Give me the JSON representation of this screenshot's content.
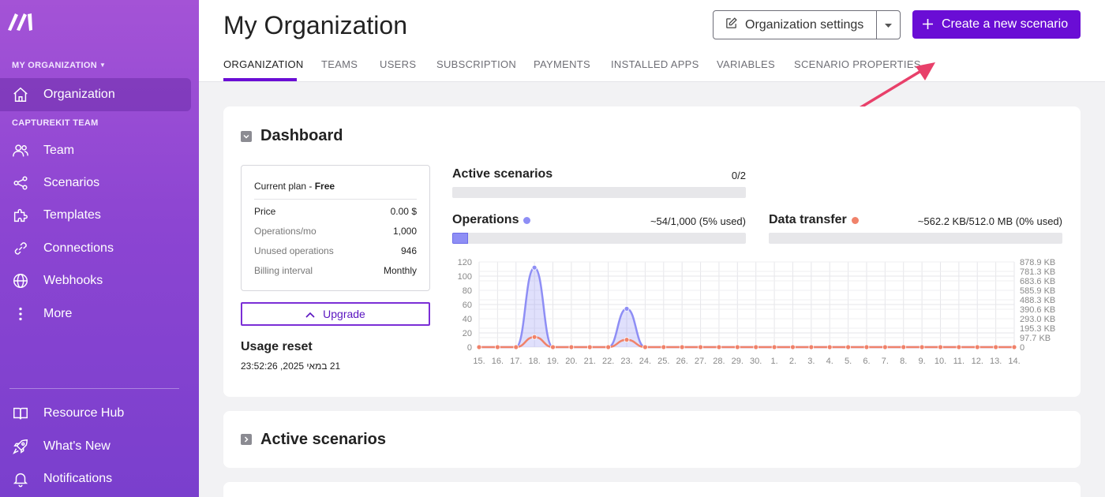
{
  "sidebar": {
    "org_switch": "MY ORGANIZATION",
    "org_item": "Organization",
    "team_label": "CAPTUREKIT TEAM",
    "items": [
      {
        "label": "Team",
        "icon": "users-icon"
      },
      {
        "label": "Scenarios",
        "icon": "share-icon"
      },
      {
        "label": "Templates",
        "icon": "puzzle-icon"
      },
      {
        "label": "Connections",
        "icon": "link-icon"
      },
      {
        "label": "Webhooks",
        "icon": "globe-icon"
      },
      {
        "label": "More",
        "icon": "more-vertical-icon"
      }
    ],
    "bottom_items": [
      {
        "label": "Resource Hub",
        "icon": "book-icon"
      },
      {
        "label": "What's New",
        "icon": "rocket-icon"
      },
      {
        "label": "Notifications",
        "icon": "bell-icon"
      }
    ]
  },
  "header": {
    "title": "My Organization",
    "settings_button": "Organization settings",
    "create_button": "Create a new scenario",
    "tabs": [
      "ORGANIZATION",
      "TEAMS",
      "USERS",
      "SUBSCRIPTION",
      "PAYMENTS",
      "INSTALLED APPS",
      "VARIABLES",
      "SCENARIO PROPERTIES"
    ],
    "active_tab": "ORGANIZATION"
  },
  "dashboard": {
    "title": "Dashboard",
    "plan": {
      "label": "Current plan - ",
      "name": "Free",
      "rows": [
        {
          "k": "Price",
          "v": "0.00 $"
        },
        {
          "k": "Operations/mo",
          "v": "1,000"
        },
        {
          "k": "Unused operations",
          "v": "946"
        },
        {
          "k": "Billing interval",
          "v": "Monthly"
        }
      ]
    },
    "upgrade_button": "Upgrade",
    "usage_reset_label": "Usage reset",
    "usage_reset_date": "21 במאי 2025, 23:52:26",
    "active_scenarios": {
      "label": "Active scenarios",
      "value": "0/2",
      "fraction": 0
    },
    "operations": {
      "label": "Operations",
      "value": "~54/1,000 (5% used)",
      "fraction": 0.054,
      "color": "#8e8ef5"
    },
    "data_transfer": {
      "label": "Data transfer",
      "value": "~562.2 KB/512.0 MB (0% used)",
      "fraction": 0.001,
      "color": "#f0826a"
    }
  },
  "active_scenarios_section": {
    "title": "Active scenarios"
  },
  "chart_data": {
    "type": "line",
    "categories": [
      "15.",
      "16.",
      "17.",
      "18.",
      "19.",
      "20.",
      "21.",
      "22.",
      "23.",
      "24.",
      "25.",
      "26.",
      "27.",
      "28.",
      "29.",
      "30.",
      "1.",
      "2.",
      "3.",
      "4.",
      "5.",
      "6.",
      "7.",
      "8.",
      "9.",
      "10.",
      "11.",
      "12.",
      "13.",
      "14."
    ],
    "series": [
      {
        "name": "Operations",
        "axis": "left",
        "color": "#8e8ef5",
        "values": [
          0,
          0,
          0,
          112,
          0,
          0,
          0,
          0,
          54,
          0,
          0,
          0,
          0,
          0,
          0,
          0,
          0,
          0,
          0,
          0,
          0,
          0,
          0,
          0,
          0,
          0,
          0,
          0,
          0,
          0
        ]
      },
      {
        "name": "Data transfer",
        "axis": "right",
        "color": "#f0826a",
        "values": [
          0,
          0,
          0,
          104,
          0,
          0,
          0,
          0,
          76,
          0,
          0,
          0,
          0,
          0,
          0,
          0,
          0,
          0,
          0,
          0,
          0,
          0,
          0,
          0,
          0,
          0,
          0,
          0,
          0,
          0
        ]
      }
    ],
    "ylim_left": [
      0,
      120
    ],
    "yticks_left": [
      "0",
      "20",
      "40",
      "60",
      "80",
      "100",
      "120"
    ],
    "ylim_right": [
      0,
      878.9
    ],
    "yticks_right": [
      "0",
      "97.7 KB",
      "195.3 KB",
      "293.0 KB",
      "390.6 KB",
      "488.3 KB",
      "585.9 KB",
      "683.6 KB",
      "781.3 KB",
      "878.9 KB"
    ],
    "grid": true
  }
}
